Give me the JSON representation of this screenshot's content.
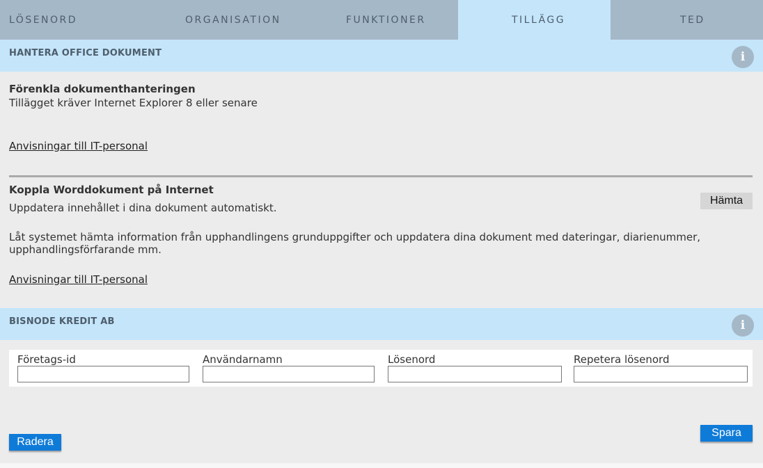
{
  "tabs": [
    {
      "label": "LÖSENORD"
    },
    {
      "label": "ORGANISATION"
    },
    {
      "label": "FUNKTIONER"
    },
    {
      "label": "TILLÄGG",
      "active": true
    },
    {
      "label": "TED"
    }
  ],
  "office_section": {
    "title": "HANTERA OFFICE DOKUMENT",
    "info_icon": "info-icon",
    "block1": {
      "heading": "Förenkla dokumenthanteringen",
      "text": "Tillägget kräver Internet Explorer 8 eller senare",
      "link": "Anvisningar till IT-personal"
    },
    "block2": {
      "heading": "Koppla Worddokument på Internet",
      "text1": "Uppdatera innehållet i dina dokument automatiskt.",
      "text2_line1": "Låt systemet hämta information från upphandlingens grunduppgifter och uppdatera dina dokument med dateringar, diarienummer,",
      "text2_line2": "upphandlingsförfarande mm.",
      "link": "Anvisningar till IT-personal",
      "button": "Hämta"
    }
  },
  "bisnode_section": {
    "title": "BISNODE KREDIT AB",
    "info_icon": "info-icon",
    "fields": [
      {
        "label": "Företags-id",
        "value": ""
      },
      {
        "label": "Användarnamn",
        "value": ""
      },
      {
        "label": "Lösenord",
        "value": ""
      },
      {
        "label": "Repetera lösenord",
        "value": ""
      }
    ],
    "delete_button": "Radera",
    "save_button": "Spara"
  },
  "colors": {
    "tab_bar": "#a5b8c8",
    "active_tab": "#c4e5fa",
    "primary_button": "#0f7bd8",
    "page_background": "#ececec"
  }
}
